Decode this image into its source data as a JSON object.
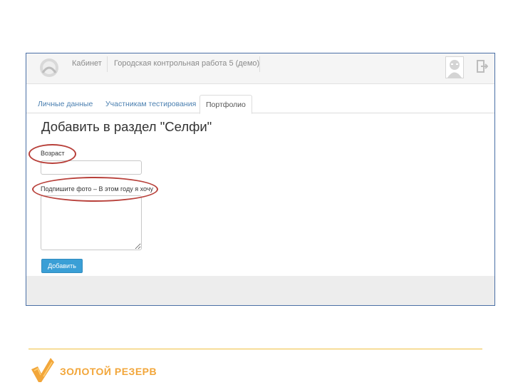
{
  "topbar": {
    "nav": {
      "cabinet": "Кабинет",
      "test": "Городская контрольная работа 5 (демо)"
    }
  },
  "tabs": {
    "personal": "Личные данные",
    "participants": "Участникам тестирования",
    "portfolio": "Портфолио"
  },
  "form": {
    "title": "Добавить в раздел \"Селфи\"",
    "age_label": "Возраст",
    "age_value": "",
    "caption_label": "Подпишите фото – В этом году я хочу",
    "caption_value": "",
    "submit_label": "Добавить"
  },
  "footer": {
    "brand": "ЗОЛОТОЙ РЕЗЕРВ"
  },
  "colors": {
    "frame_border": "#4a6fa5",
    "tab_link": "#4a7fb0",
    "button": "#3a9fd6",
    "highlight": "#b8403a",
    "brand_orange": "#f2a63a",
    "divider": "#f0c040"
  }
}
